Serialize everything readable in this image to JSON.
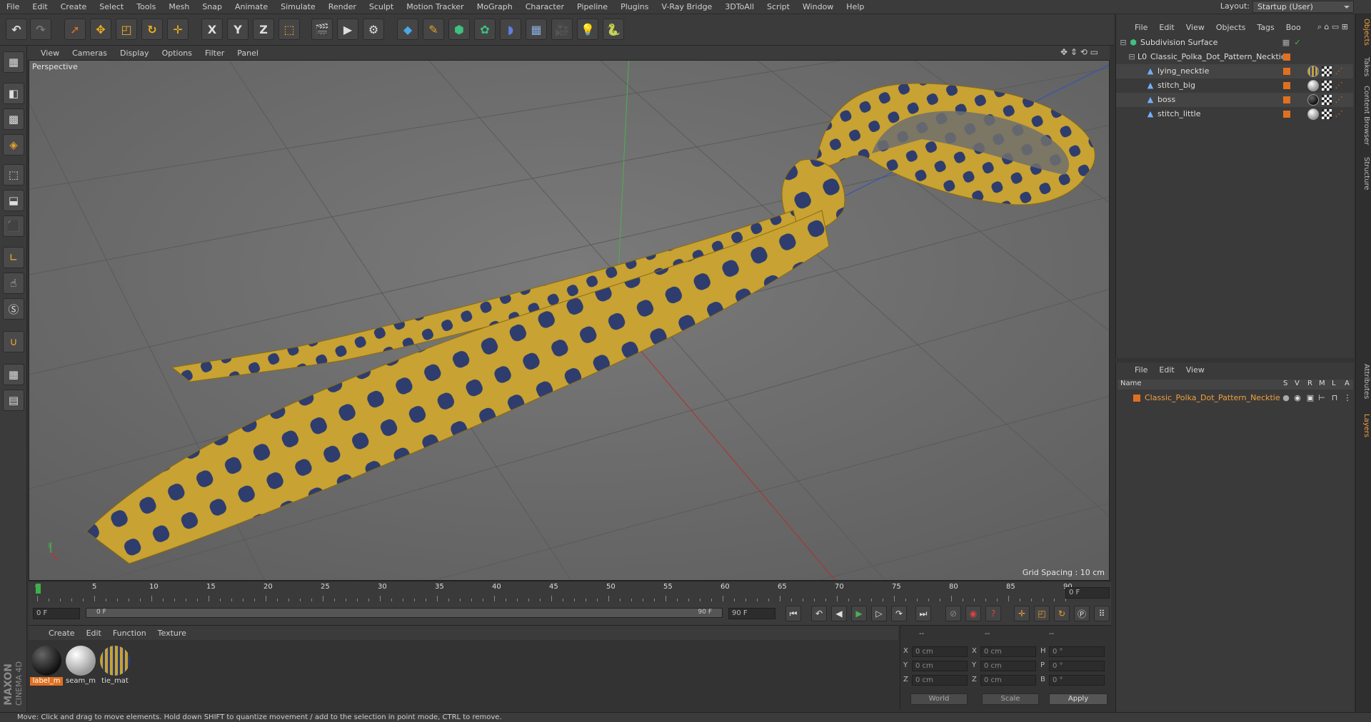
{
  "menubar": {
    "items": [
      "File",
      "Edit",
      "Create",
      "Select",
      "Tools",
      "Mesh",
      "Snap",
      "Animate",
      "Simulate",
      "Render",
      "Sculpt",
      "Motion Tracker",
      "MoGraph",
      "Character",
      "Pipeline",
      "Plugins",
      "V-Ray Bridge",
      "3DToAll",
      "Script",
      "Window",
      "Help"
    ],
    "layout_label": "Layout:",
    "layout_value": "Startup (User)"
  },
  "toolbar": {
    "axis_x": "X",
    "axis_y": "Y",
    "axis_z": "Z"
  },
  "lefttools": {
    "brand_line1": "MAXON",
    "brand_line2": "CINEMA 4D"
  },
  "viewport": {
    "menu": [
      "View",
      "Cameras",
      "Display",
      "Options",
      "Filter",
      "Panel"
    ],
    "label": "Perspective",
    "grid_spacing": "Grid Spacing : 10 cm",
    "axis_gizmo_y": "y"
  },
  "timeline": {
    "ticks": [
      "0",
      "5",
      "10",
      "15",
      "20",
      "25",
      "30",
      "35",
      "40",
      "45",
      "50",
      "55",
      "60",
      "65",
      "70",
      "75",
      "80",
      "85",
      "90"
    ],
    "current_frame_label": "0 F",
    "start_field": "0 F",
    "range_start": "0 F",
    "range_end": "90 F",
    "end_field": "90 F"
  },
  "materials": {
    "menu": [
      "Create",
      "Edit",
      "Function",
      "Texture"
    ],
    "items": [
      {
        "name": "label_m",
        "color": "#1a1a1a",
        "selected": true
      },
      {
        "name": "seam_m",
        "color": "#d8d8d8",
        "selected": false
      },
      {
        "name": "tie_mat",
        "color": "#c8a232",
        "selected": false
      }
    ]
  },
  "coords": {
    "header": [
      "--",
      "--",
      "--"
    ],
    "rows": [
      {
        "l1": "X",
        "v1": "0 cm",
        "l2": "X",
        "v2": "0 cm",
        "l3": "H",
        "v3": "0 °"
      },
      {
        "l1": "Y",
        "v1": "0 cm",
        "l2": "Y",
        "v2": "0 cm",
        "l3": "P",
        "v3": "0 °"
      },
      {
        "l1": "Z",
        "v1": "0 cm",
        "l2": "Z",
        "v2": "0 cm",
        "l3": "B",
        "v3": "0 °"
      }
    ],
    "mode": "World",
    "type": "Scale",
    "apply": "Apply"
  },
  "status": {
    "text": "Move: Click and drag to move elements. Hold down SHIFT to quantize movement / add to the selection in point mode, CTRL to remove."
  },
  "objects": {
    "menu": [
      "File",
      "Edit",
      "View",
      "Objects",
      "Tags",
      "Boo"
    ],
    "items": [
      {
        "name": "Subdivision Surface",
        "indent": 0,
        "icon": "subdivision-icon",
        "color": "#e0e0e0"
      },
      {
        "name": "Classic_Polka_Dot_Pattern_Necktie",
        "indent": 1,
        "icon": "null-icon",
        "color": "#e0e0e0"
      },
      {
        "name": "lying_necktie",
        "indent": 2,
        "icon": "polygon-icon",
        "color": "#e0e0e0"
      },
      {
        "name": "stitch_big",
        "indent": 2,
        "icon": "polygon-icon",
        "color": "#e0e0e0"
      },
      {
        "name": "boss",
        "indent": 2,
        "icon": "polygon-icon",
        "color": "#e0e0e0"
      },
      {
        "name": "stitch_little",
        "indent": 2,
        "icon": "polygon-icon",
        "color": "#e0e0e0"
      }
    ]
  },
  "layers": {
    "menu": [
      "File",
      "Edit",
      "View"
    ],
    "header": {
      "name": "Name",
      "s": "S",
      "v": "V",
      "r": "R",
      "m": "M",
      "l": "L",
      "a": "A"
    },
    "items": [
      {
        "name": "Classic_Polka_Dot_Pattern_Necktie",
        "color": "#e07020"
      }
    ]
  },
  "sidetabs": [
    "Objects",
    "Takes",
    "Content Browser",
    "Structure",
    "Attributes",
    "Layers"
  ],
  "colors": {
    "accent_orange": "#e07020",
    "tie_yellow": "#c8a232",
    "tie_dot_blue": "#2e3d6e",
    "play_green": "#4caf50"
  }
}
